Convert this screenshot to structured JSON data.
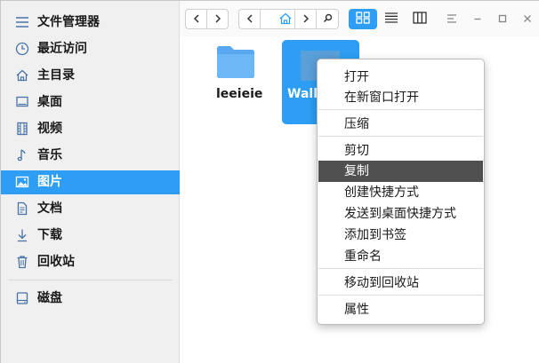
{
  "sidebar": {
    "items": [
      {
        "label": "文件管理器",
        "icon": "menu-icon"
      },
      {
        "label": "最近访问",
        "icon": "clock-icon"
      },
      {
        "label": "主目录",
        "icon": "home-icon"
      },
      {
        "label": "桌面",
        "icon": "desktop-icon"
      },
      {
        "label": "视频",
        "icon": "film-icon"
      },
      {
        "label": "音乐",
        "icon": "music-icon"
      },
      {
        "label": "图片",
        "icon": "image-icon"
      },
      {
        "label": "文档",
        "icon": "document-icon"
      },
      {
        "label": "下载",
        "icon": "download-icon"
      },
      {
        "label": "回收站",
        "icon": "trash-icon"
      },
      {
        "label": "磁盘",
        "icon": "disk-icon"
      }
    ],
    "active_index": 6
  },
  "toolbar": {
    "back": "‹",
    "forward": "›",
    "search_glyph": "⌕"
  },
  "files": [
    {
      "name": "leeieie",
      "type": "folder"
    },
    {
      "name": "Wallp",
      "type": "folder",
      "selected": true
    }
  ],
  "context_menu": {
    "groups": [
      [
        "打开",
        "在新窗口打开"
      ],
      [
        "压缩"
      ],
      [
        "剪切",
        "复制",
        "创建快捷方式",
        "发送到桌面快捷方式",
        "添加到书签",
        "重命名"
      ],
      [
        "移动到回收站"
      ],
      [
        "属性"
      ]
    ],
    "highlighted": "复制"
  },
  "colors": {
    "accent": "#2d9ef3",
    "menu_highlight": "#505050",
    "sidebar_bg": "#f0f0f0"
  }
}
